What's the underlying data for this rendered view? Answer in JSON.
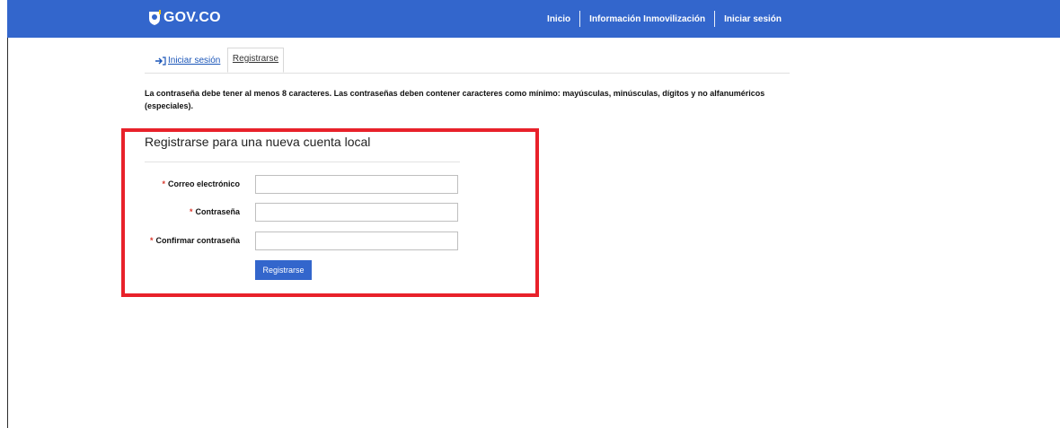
{
  "header": {
    "logo_text": "GOV.CO",
    "nav": [
      "Inicio",
      "Información Inmovilización",
      "Iniciar sesión"
    ]
  },
  "tabs": {
    "login_label": "Iniciar sesión",
    "register_label": "Registrarse"
  },
  "notice": "La contraseña debe tener al menos 8 caracteres. Las contraseñas deben contener caracteres como mínimo: mayúsculas, minúsculas, dígitos y no alfanuméricos (especiales).",
  "form": {
    "title": "Registrarse para una nueva cuenta local",
    "required_mark": "*",
    "fields": [
      {
        "label": "Correo electrónico",
        "value": ""
      },
      {
        "label": "Contraseña",
        "value": ""
      },
      {
        "label": "Confirmar contraseña",
        "value": ""
      }
    ],
    "submit_label": "Registrarse"
  },
  "colors": {
    "header_bg": "#3366cc",
    "highlight_border": "#e8212a",
    "link": "#1a55b8",
    "required": "#d9372c"
  }
}
